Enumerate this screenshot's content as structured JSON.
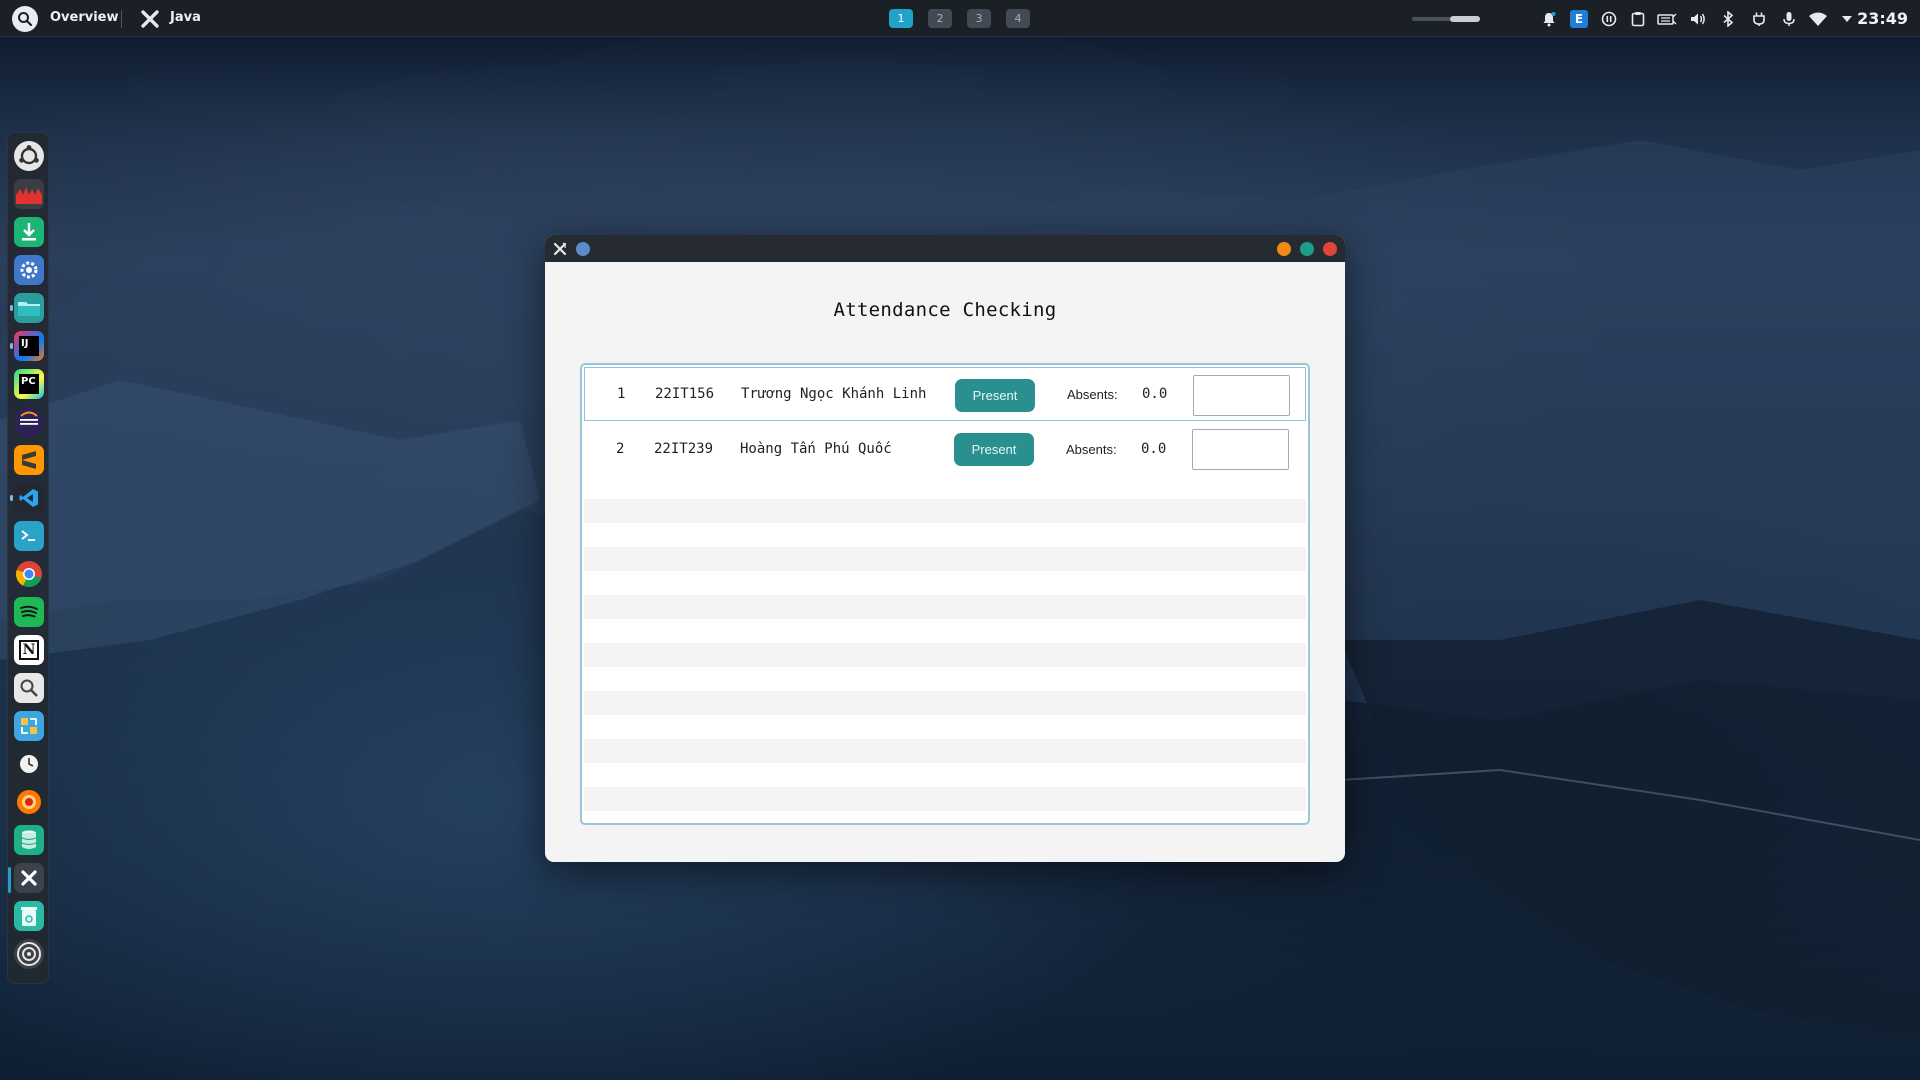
{
  "topbar": {
    "overview_label": "Overview",
    "app_name": "Java",
    "workspaces": [
      "1",
      "2",
      "3",
      "4"
    ],
    "active_workspace": "1",
    "clock": "23:49",
    "tray_icons": [
      "notification-bell-icon",
      "e-app-icon",
      "pause-icon",
      "clipboard-icon",
      "network-card-icon",
      "volume-icon",
      "bluetooth-icon",
      "power-plug-icon",
      "microphone-icon",
      "wifi-icon",
      "dropdown-arrow-icon"
    ]
  },
  "dock": {
    "apps": [
      "ubuntu-icon",
      "system-monitor-icon",
      "download-manager-icon",
      "settings-icon",
      "files-icon",
      "intellij-icon",
      "pycharm-icon",
      "eclipse-icon",
      "sublime-text-icon",
      "vscode-icon",
      "terminal-icon",
      "chrome-icon",
      "spotify-icon",
      "notion-icon",
      "magnifier-icon",
      "screenshot-icon",
      "clock-icon",
      "browser-icon",
      "database-icon",
      "java-app-icon",
      "trash-icon",
      "disk-icon"
    ]
  },
  "window": {
    "title": "Attendance Checking",
    "rows": [
      {
        "index": "1",
        "student_id": "22IT156",
        "name": "Trương Ngọc Khánh Linh",
        "button_label": "Present",
        "absents_label": "Absents:",
        "absents_value": "0.0",
        "input_value": ""
      },
      {
        "index": "2",
        "student_id": "22IT239",
        "name": "Hoàng Tấn Phú Quốc",
        "button_label": "Present",
        "absents_label": "Absents:",
        "absents_value": "0.0",
        "input_value": ""
      }
    ]
  },
  "colors": {
    "accent_workspace": "#1fa3c6",
    "present_button": "#2a8f8f",
    "window_close": "#e0443c",
    "window_maximize": "#1aa08a",
    "window_minimize": "#f08a14"
  }
}
